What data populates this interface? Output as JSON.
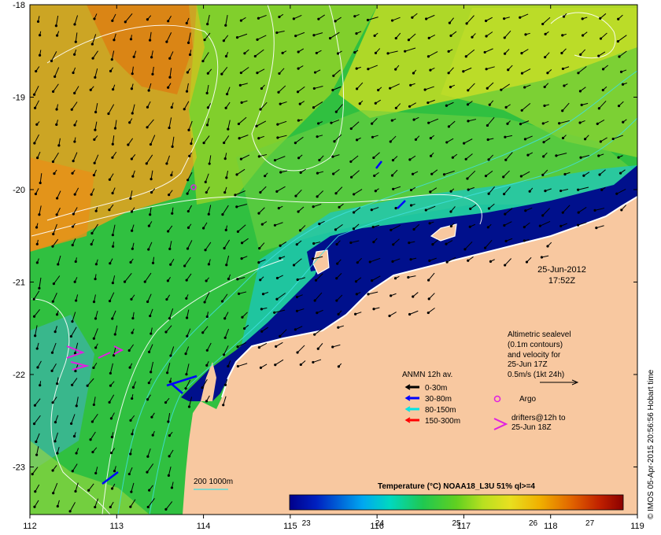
{
  "map": {
    "lon_ticks": [
      "112",
      "113",
      "114",
      "115",
      "116",
      "117",
      "118",
      "119"
    ],
    "lat_ticks": [
      "-18",
      "-19",
      "-20",
      "-21",
      "-22",
      "-23"
    ],
    "date": "25-Jun-2012",
    "time": "17:52Z",
    "credit": "© IMOS 05-Apr-2015 20:56:56 Hobart time"
  },
  "notes": {
    "altimetry": [
      "Altimetric sealevel",
      "(0.1m contours)",
      "and velocity for",
      "25-Jun 17Z",
      "0.5m/s (1kt 24h)"
    ],
    "argo": "Argo",
    "drifters": [
      "drifters@12h to",
      "25-Jun 18Z"
    ],
    "depth_contours": "200  1000m"
  },
  "legend": {
    "title": "ANMN 12h av.",
    "items": [
      {
        "label": "0-30m",
        "color": "#000000"
      },
      {
        "label": "30-80m",
        "color": "#0000ff"
      },
      {
        "label": "80-150m",
        "color": "#00e5e5"
      },
      {
        "label": "150-300m",
        "color": "#ff0000"
      }
    ]
  },
  "colorbar": {
    "title": "Temperature (°C) NOAA18_L3U 51% ql>=4",
    "ticks": [
      "23",
      "24",
      "25",
      "26",
      "27"
    ],
    "colors": [
      "#00008b",
      "#0030d0",
      "#00a0f0",
      "#00d8c8",
      "#20c860",
      "#50d020",
      "#a8e020",
      "#e8e020",
      "#f0b000",
      "#e07000",
      "#c03000",
      "#8b0000"
    ]
  },
  "colors": {
    "land": "#f8c8a0",
    "cold_water": "#00108c"
  }
}
